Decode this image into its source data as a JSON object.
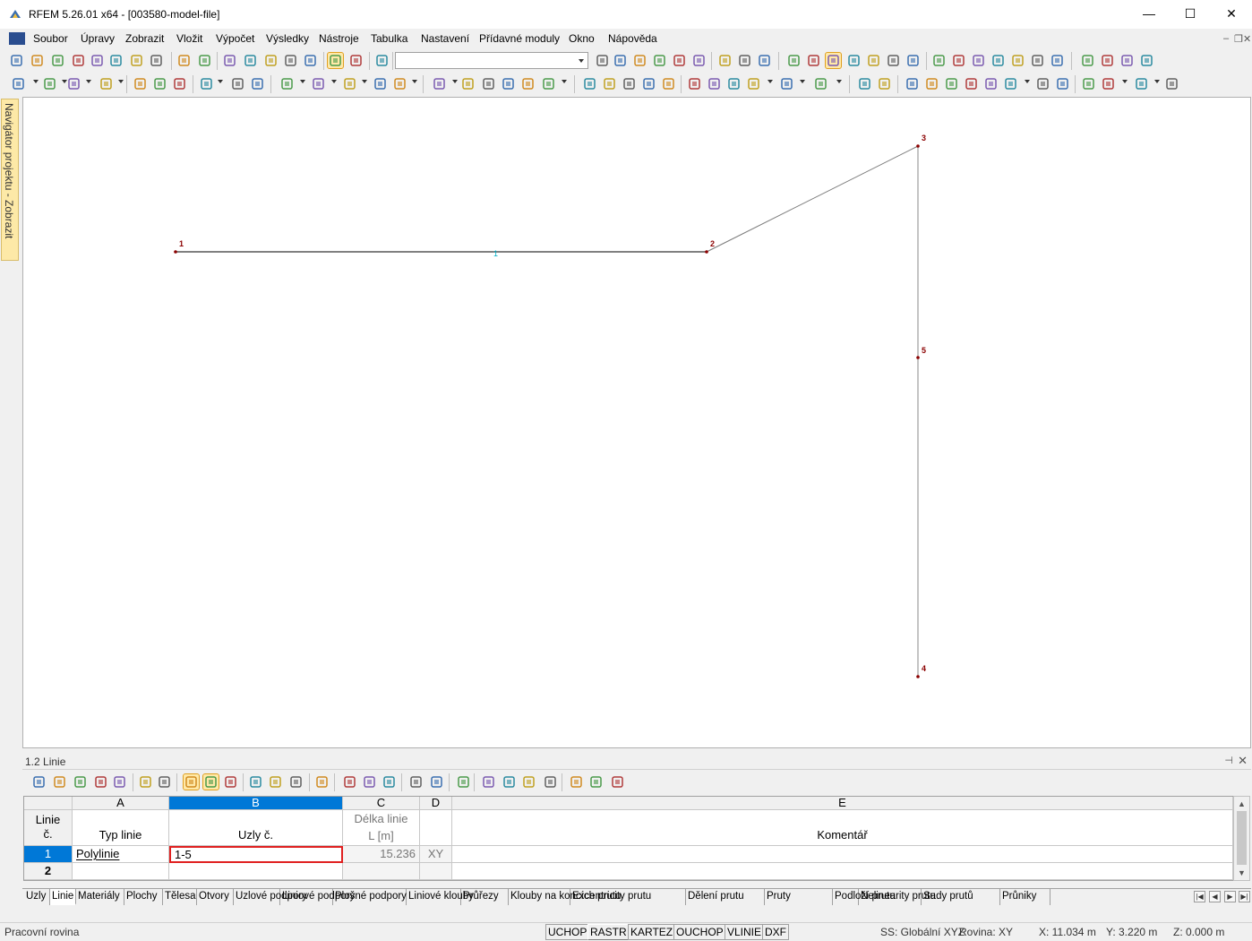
{
  "window": {
    "title": "RFEM 5.26.01 x64 - [003580-model-file]",
    "minimize": "—",
    "maximize": "☐",
    "close": "✕"
  },
  "menu": [
    {
      "label": "Soubor"
    },
    {
      "label": "Úpravy"
    },
    {
      "label": "Zobrazit"
    },
    {
      "label": "Vložit"
    },
    {
      "label": "Výpočet"
    },
    {
      "label": "Výsledky"
    },
    {
      "label": "Nástroje"
    },
    {
      "label": "Tabulka"
    },
    {
      "label": "Nastavení"
    },
    {
      "label": "Přídavné moduly"
    },
    {
      "label": "Okno"
    },
    {
      "label": "Nápověda"
    }
  ],
  "mdi_controls": {
    "minimize": "–",
    "restore": "❐",
    "close": "✕"
  },
  "navigator": {
    "label": "Navigátor projektu - Zobrazit"
  },
  "model": {
    "nodes": [
      {
        "id": "1"
      },
      {
        "id": "2"
      },
      {
        "id": "3"
      },
      {
        "id": "4"
      },
      {
        "id": "5"
      }
    ],
    "line_label": "1",
    "colors": {
      "node": "#8b0000",
      "line": "#000000",
      "node_label": "#8b0000",
      "line_label": "#00b0c8"
    }
  },
  "panel": {
    "title": "1.2 Linie",
    "pin": "⊣",
    "close": "✕"
  },
  "table": {
    "col_letters": [
      "A",
      "B",
      "C",
      "D",
      "E"
    ],
    "headers": {
      "no": "Linie č.",
      "type": "Typ linie",
      "nodes": "Uzly č.",
      "length_1": "Délka linie",
      "length_2": "L [m]",
      "plane": "",
      "comment": "Komentář"
    },
    "rows": [
      {
        "no": "1",
        "type": "Polylinie",
        "nodes": "1-5",
        "length": "15.236",
        "plane": "XY",
        "comment": ""
      },
      {
        "no": "2",
        "type": "",
        "nodes": "",
        "length": "",
        "plane": "",
        "comment": ""
      }
    ]
  },
  "sheet_tabs": [
    {
      "label": "Uzly"
    },
    {
      "label": "Linie"
    },
    {
      "label": "Materiály"
    },
    {
      "label": "Plochy"
    },
    {
      "label": "Tělesa"
    },
    {
      "label": "Otvory"
    },
    {
      "label": "Uzlové podpory"
    },
    {
      "label": "Liniové podpory"
    },
    {
      "label": "Plošné podpory"
    },
    {
      "label": "Liniové klouby"
    },
    {
      "label": "Průřezy"
    },
    {
      "label": "Klouby na koncích prutu"
    },
    {
      "label": "Excentricity prutu"
    },
    {
      "label": "Dělení prutu"
    },
    {
      "label": "Pruty"
    },
    {
      "label": "Podloží prutu"
    },
    {
      "label": "Nelinearity prutu"
    },
    {
      "label": "Sady prutů"
    },
    {
      "label": "Průniky"
    }
  ],
  "sheet_nav": [
    "|◀",
    "◀",
    "▶",
    "▶|"
  ],
  "status": {
    "left": "Pracovní rovina",
    "toggles": [
      "UCHOP",
      "RASTR",
      "KARTEZ",
      "OUCHOP",
      "VLINIE",
      "DXF"
    ],
    "cs": "SS: Globální XYZ",
    "plane": "Rovina: XY",
    "x": "X:  11.034 m",
    "y": "Y:  3.220 m",
    "z": "Z:  0.000 m"
  }
}
